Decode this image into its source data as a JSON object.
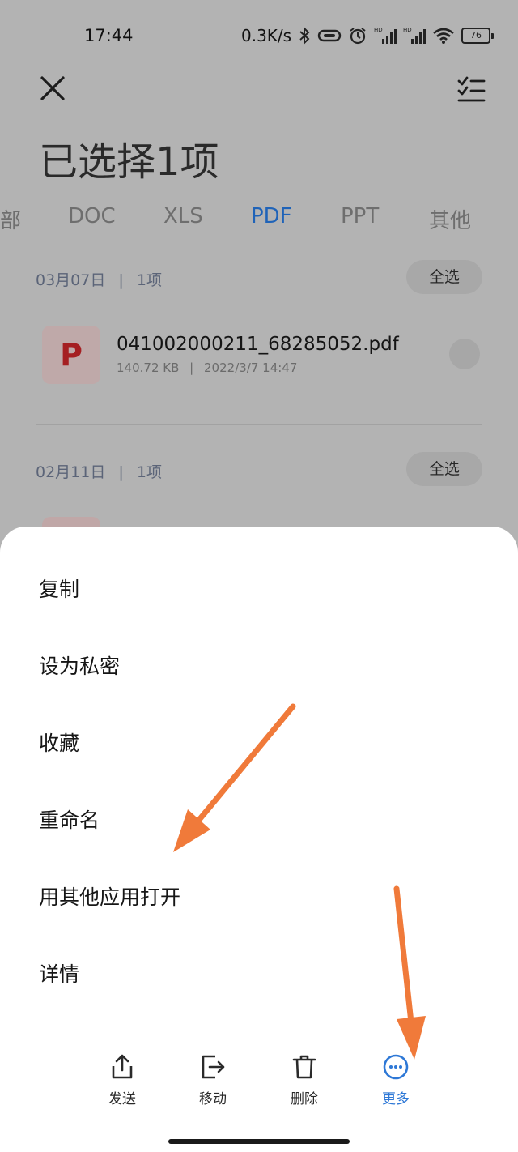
{
  "status_bar": {
    "time": "17:44",
    "network_speed": "0.3K/s",
    "battery_level": "76"
  },
  "header": {
    "title": "已选择1项"
  },
  "tabs": [
    {
      "label": "部",
      "active": false
    },
    {
      "label": "DOC",
      "active": false
    },
    {
      "label": "XLS",
      "active": false
    },
    {
      "label": "PDF",
      "active": true
    },
    {
      "label": "PPT",
      "active": false
    },
    {
      "label": "其他",
      "active": false
    }
  ],
  "groups": [
    {
      "date": "03月07日",
      "count": "1项",
      "select_all_label": "全选"
    },
    {
      "date": "02月11日",
      "count": "1项",
      "select_all_label": "全选"
    }
  ],
  "file": {
    "icon_letter": "P",
    "name": "041002000211_68285052.pdf",
    "size": "140.72 KB",
    "modified": "2022/3/7 14:47"
  },
  "menu": [
    "复制",
    "设为私密",
    "收藏",
    "重命名",
    "用其他应用打开",
    "详情"
  ],
  "actions": [
    {
      "label": "发送",
      "icon": "share-icon"
    },
    {
      "label": "移动",
      "icon": "move-icon"
    },
    {
      "label": "删除",
      "icon": "trash-icon"
    },
    {
      "label": "更多",
      "icon": "more-icon"
    }
  ],
  "colors": {
    "accent": "#2e78d6",
    "active_tab": "#1f63b8",
    "arrow": "#f07a3a"
  }
}
